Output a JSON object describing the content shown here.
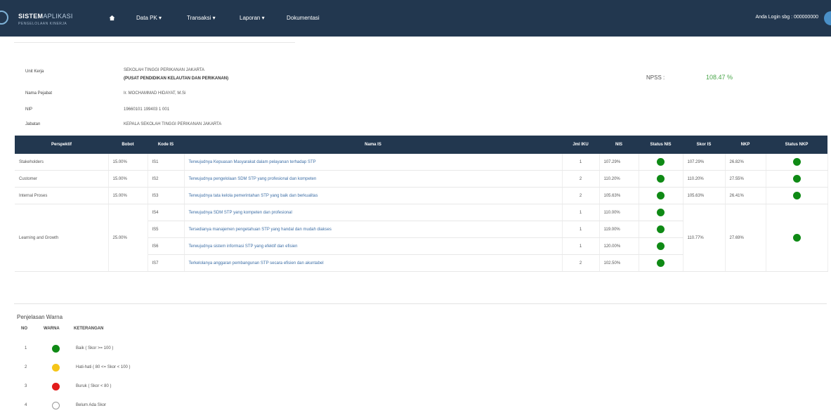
{
  "navbar": {
    "brand_title_main": "SISTEM",
    "brand_title_sub": "APLIKASI",
    "brand_subtitle": "PENGELOLAAN KINERJA",
    "home_icon": "home-icon",
    "menu": [
      "Data PK ▾",
      "Transaksi ▾",
      "Laporan ▾",
      "Dokumentasi"
    ],
    "user_text": "Anda Login sbg : 000000000",
    "colors": {
      "background": "#22374f",
      "text": "#ffffff"
    }
  },
  "info": {
    "unit_label": "Unit Kerja",
    "unit_value_line1": "SEKOLAH TINGGI PERIKANAN JAKARTA",
    "unit_value_line2": "(PUSAT PENDIDIKAN KELAUTAN DAN PERIKANAN)",
    "name_label": "Nama Pejabat",
    "name_value": "Ir. MOCHAMMAD HIDAYAT, M.Si",
    "nip_label": "NIP",
    "nip_value": "19660101 199403 1 001",
    "position_label": "Jabatan",
    "position_value": "KEPALA SEKOLAH TINGGI PERIKANAN JAKARTA",
    "npsi_label": "NPSS :",
    "npsi_value": "108.47 %",
    "npsi_color": "#4aa64a"
  },
  "table": {
    "headers": [
      "Perspektif",
      "Bobot",
      "Kode IS",
      "Nama IS",
      "Jml IKU",
      "NIS",
      "Status NIS",
      "Skor IS",
      "NKP",
      "Status NKP"
    ],
    "rows": [
      {
        "perspektif": "Stakeholders",
        "bobot": "15.00%",
        "kode": "IS1",
        "nama": "Terwujudnya Kepuasan Masyarakat dalam pelayanan terhadap STP",
        "jml": "1",
        "nis": "107.29%",
        "status_nis": "green",
        "skor": "107.29%",
        "nkp": "26.82%",
        "status_nkp": "green"
      },
      {
        "perspektif": "Customer",
        "bobot": "15.00%",
        "kode": "IS2",
        "nama": "Terwujudnya pengelolaan SDM STP yang profesional dan kompeten",
        "jml": "2",
        "nis": "110.20%",
        "status_nis": "green",
        "skor": "110.20%",
        "nkp": "27.55%",
        "status_nkp": "green"
      },
      {
        "perspektif": "Internal Proses",
        "bobot": "15.00%",
        "kode": "IS3",
        "nama": "Terwujudnya tata kelola pemerintahan STP yang baik dan berkualitas",
        "jml": "2",
        "nis": "105.63%",
        "status_nis": "green",
        "skor": "105.63%",
        "nkp": "26.41%",
        "status_nkp": "green"
      },
      {
        "perspektif": "Learning and Growth",
        "bobot": "25.00%",
        "kode": "IS4",
        "nama": "Terwujudnya SDM STP yang kompeten dan profesional",
        "jml": "1",
        "nis": "110.00%",
        "status_nis": "green",
        "skor": "110.77%",
        "nkp": "27.69%",
        "status_nkp": "green"
      },
      {
        "kode": "IS5",
        "nama": "Tersedianya manajemen pengetahuan STP yang handal dan mudah diakses",
        "jml": "1",
        "nis": "119.00%",
        "status_nis": "green"
      },
      {
        "kode": "IS6",
        "nama": "Terwujudnya sistem informasi STP yang efektif dan efisien",
        "jml": "1",
        "nis": "120.00%",
        "status_nis": "green"
      },
      {
        "kode": "IS7",
        "nama": "Terkelolanya anggaran pembangunan STP secara efisien dan akuntabel",
        "jml": "2",
        "nis": "102.50%",
        "status_nis": "green"
      }
    ]
  },
  "legend": {
    "title": "Penjelasan Warna",
    "headers": [
      "NO",
      "WARNA",
      "KETERANGAN"
    ],
    "items": [
      {
        "no": "1",
        "color": "green",
        "text": "Baik ( Skor >= 100 )"
      },
      {
        "no": "2",
        "color": "yellow",
        "text": "Hati-hati ( 80 <= Skor < 100 )"
      },
      {
        "no": "3",
        "color": "red",
        "text": "Buruk ( Skor < 80 )"
      },
      {
        "no": "4",
        "color": "empty",
        "text": "Belum Ada Skor"
      }
    ]
  }
}
